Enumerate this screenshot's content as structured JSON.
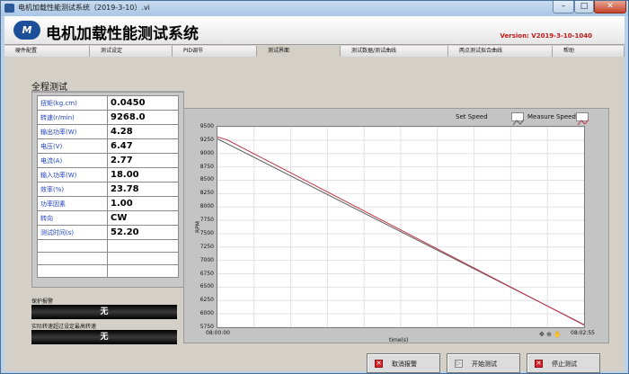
{
  "window": {
    "title": "电机加载性能测试系统（2019-3-10）.vi"
  },
  "header": {
    "app_title": "电机加载性能测试系统",
    "version": "Version: V2019-3-10-1040",
    "logo_text": "M"
  },
  "tabs": [
    {
      "label": "硬件配置"
    },
    {
      "label": "测试设定"
    },
    {
      "label": "PID调节"
    },
    {
      "label": "测试界面",
      "active": true
    },
    {
      "label": "测试数据/测试曲线"
    },
    {
      "label": "两点测试拟合曲线"
    },
    {
      "label": "帮助"
    }
  ],
  "section": {
    "title": "全程测试"
  },
  "measurements": [
    {
      "label": "扭矩(kg.cm)",
      "value": "0.0450"
    },
    {
      "label": "转速(r/min)",
      "value": "9268.0"
    },
    {
      "label": "输出功率(W)",
      "value": "4.28"
    },
    {
      "label": "电压(V)",
      "value": "6.47"
    },
    {
      "label": "电流(A)",
      "value": "2.77"
    },
    {
      "label": "输入功率(W)",
      "value": "18.00"
    },
    {
      "label": "效率(%)",
      "value": "23.78"
    },
    {
      "label": "功率因素",
      "value": "1.00"
    },
    {
      "label": "转向",
      "value": "CW"
    },
    {
      "label": "测试时间(s)",
      "value": "52.20"
    }
  ],
  "alarms": [
    {
      "label": "保护报警",
      "value": "无"
    },
    {
      "label": "实际转速超过设定最高转速",
      "value": "无"
    }
  ],
  "chart_data": {
    "type": "line",
    "xlabel": "time(s)",
    "ylabel": "RPM",
    "ylim": [
      5750,
      9500
    ],
    "yticks": [
      9500,
      9250,
      9000,
      8750,
      8500,
      8250,
      8000,
      7750,
      7500,
      7250,
      7000,
      6750,
      6500,
      6250,
      6000,
      5750
    ],
    "xticks": [
      "08:00:00",
      "08:02:55"
    ],
    "grid": true,
    "legend_placement": "top-right",
    "series": [
      {
        "name": "Set Speed",
        "color": "#5a5a5a",
        "points": [
          [
            0,
            9275
          ],
          [
            1,
            5800
          ]
        ]
      },
      {
        "name": "Measure Speed",
        "color": "#c0334a",
        "points": [
          [
            0,
            9310
          ],
          [
            0.025,
            9260
          ],
          [
            1,
            5790
          ]
        ]
      }
    ]
  },
  "buttons": {
    "cancel_alarm": "取消报警",
    "start_test": "开始测试",
    "stop_test": "停止测试"
  }
}
